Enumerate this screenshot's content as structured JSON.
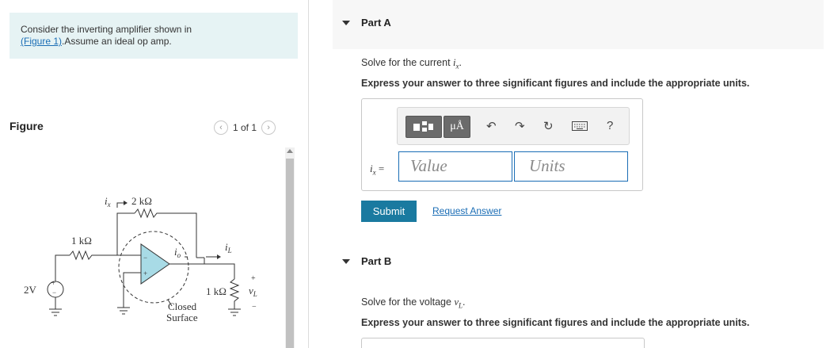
{
  "problem": {
    "intro_text": "Consider the inverting amplifier shown in",
    "figure_link": "(Figure 1)",
    "intro_text2": ".Assume an ideal op amp."
  },
  "figure": {
    "title": "Figure",
    "page_indicator": "1 of 1",
    "prev_icon": "chevron-left-icon",
    "next_icon": "chevron-right-icon",
    "circuit": {
      "source_label": "2V",
      "r1_label": "1 kΩ",
      "rf_label": "2 kΩ",
      "rl_label": "1 kΩ",
      "ix_label": "i",
      "ix_sub": "x",
      "io_label": "i",
      "io_sub": "o",
      "il_label": "i",
      "il_sub": "L",
      "vl_label": "v",
      "vl_sub": "L",
      "plus": "+",
      "minus": "−",
      "closed_surface_line1": "Closed",
      "closed_surface_line2": "Surface"
    }
  },
  "partA": {
    "header": "Part A",
    "question_prefix": "Solve for the current ",
    "question_var": "i",
    "question_sub": "x",
    "question_suffix": ".",
    "instruction": "Express your answer to three significant figures and include the appropriate units.",
    "toolbar": {
      "templates_icon": "templates-icon",
      "units_button": "μÅ",
      "undo_icon": "undo-icon",
      "redo_icon": "redo-icon",
      "reset_icon": "reset-icon",
      "keyboard_icon": "keyboard-icon",
      "help_label": "?"
    },
    "eq_var": "i",
    "eq_sub": "x",
    "eq_sign": " =",
    "value_placeholder": "Value",
    "units_placeholder": "Units",
    "submit_label": "Submit",
    "request_answer_label": "Request Answer"
  },
  "partB": {
    "header": "Part B",
    "question_prefix": "Solve for the voltage ",
    "question_var": "v",
    "question_sub": "L",
    "question_suffix": ".",
    "instruction": "Express your answer to three significant figures and include the appropriate units."
  },
  "colors": {
    "intro_bg": "#e6f3f4",
    "link": "#1a6db5",
    "submit_bg": "#1a7aa0",
    "opamp_fill": "#a8dbe6"
  }
}
